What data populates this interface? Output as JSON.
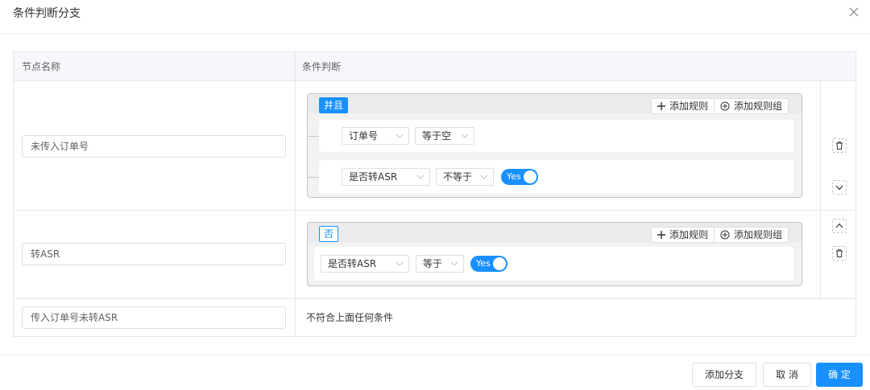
{
  "dialog": {
    "title": "条件判断分支",
    "close_icon": "close-icon"
  },
  "table": {
    "headers": {
      "name": "节点名称",
      "condition": "条件判断"
    },
    "rows": [
      {
        "name": "未传入订单号",
        "group": {
          "relation": "并且",
          "add_rule": "添加规则",
          "add_rule_group": "添加规则组",
          "rules": [
            {
              "field": "订单号",
              "operator": "等于空"
            },
            {
              "field": "是否转ASR",
              "operator": "不等于",
              "switch_label": "Yes"
            }
          ]
        }
      },
      {
        "name": "转ASR",
        "group": {
          "relation": "否",
          "add_rule": "添加规则",
          "add_rule_group": "添加规则组",
          "rules": [
            {
              "field": "是否转ASR",
              "operator": "等于",
              "switch_label": "Yes"
            }
          ]
        }
      },
      {
        "name": "传入订单号未转ASR",
        "fallback_text": "不符合上面任何条件"
      }
    ]
  },
  "footer": {
    "add_branch": "添加分支",
    "cancel": "取 消",
    "confirm": "确 定"
  },
  "colors": {
    "primary": "#1890ff",
    "border": "#dcdfe6",
    "header_bg": "#f5f7fa"
  },
  "icons": [
    "close-icon",
    "plus-icon",
    "plus-circle-icon",
    "chevron-down-icon",
    "trash-icon",
    "arrow-up-icon",
    "arrow-down-icon"
  ]
}
